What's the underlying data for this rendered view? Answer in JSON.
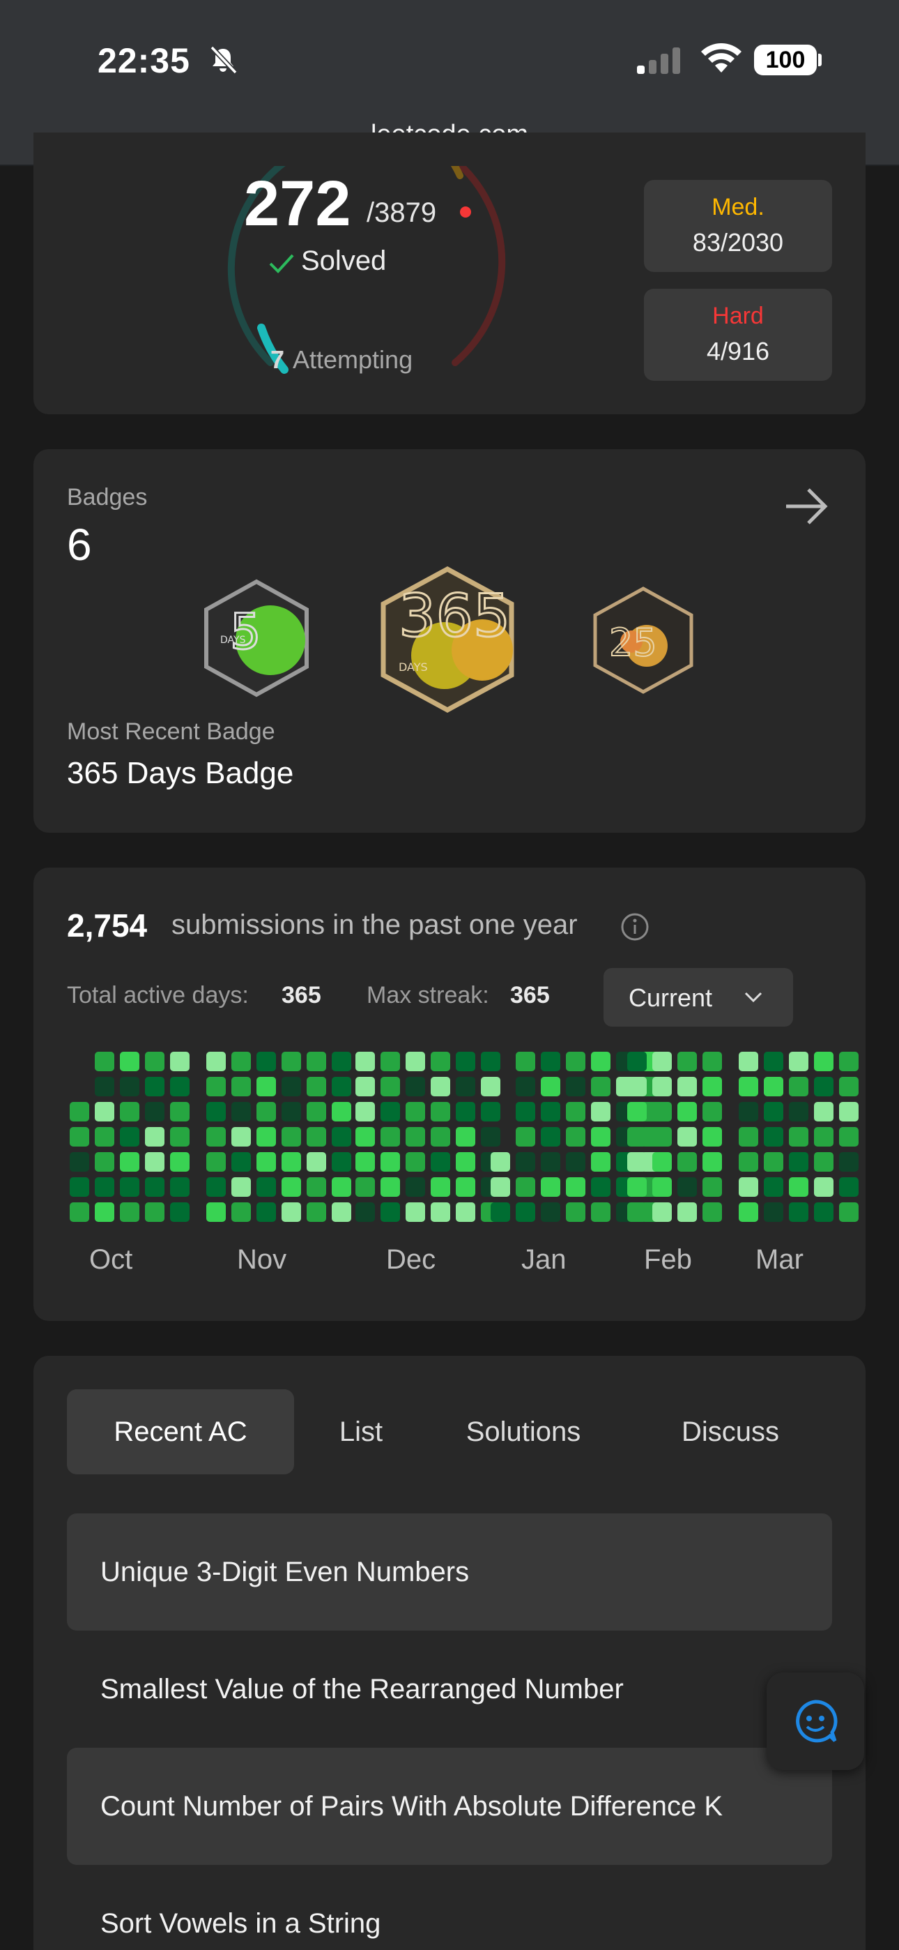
{
  "status_bar": {
    "time": "22:35",
    "battery": "100",
    "url": "leetcode.com"
  },
  "solved_card": {
    "solved": "272",
    "total": "/3879",
    "solved_label": "Solved",
    "attempting_count": "7",
    "attempting_label": "Attempting",
    "medium": {
      "label": "Med.",
      "value": "83/2030",
      "color": "#ffb800"
    },
    "hard": {
      "label": "Hard",
      "value": "4/916",
      "color": "#f63737"
    }
  },
  "badges_card": {
    "title": "Badges",
    "count": "6",
    "badges": [
      {
        "name": "50 Days Badge",
        "text": "DAYS"
      },
      {
        "name": "365 Days Badge",
        "text": "DAYS"
      },
      {
        "name": "2025 Badge",
        "text": ""
      }
    ],
    "recent_label": "Most Recent Badge",
    "recent_name": "365 Days Badge"
  },
  "submissions_card": {
    "count": "2,754",
    "text": "submissions in the past one year",
    "active_days_label": "Total active days:",
    "active_days": "365",
    "max_streak_label": "Max streak:",
    "max_streak": "365",
    "period": "Current",
    "months": [
      "Oct",
      "Nov",
      "Dec",
      "Jan",
      "Feb",
      "Mar"
    ],
    "colors": {
      "level1": "#0e4429",
      "level2": "#006d32",
      "level3": "#26a641",
      "level4": "#39d353",
      "level5": "#8ee89a"
    }
  },
  "recent_card": {
    "tabs": [
      {
        "label": "Recent AC",
        "active": true
      },
      {
        "label": "List",
        "active": false
      },
      {
        "label": "Solutions",
        "active": false
      },
      {
        "label": "Discuss",
        "active": false
      }
    ],
    "items": [
      "Unique 3-Digit Even Numbers",
      "Smallest Value of the Rearranged Number",
      "Count Number of Pairs With Absolute Difference K",
      "Sort Vowels in a String"
    ]
  }
}
